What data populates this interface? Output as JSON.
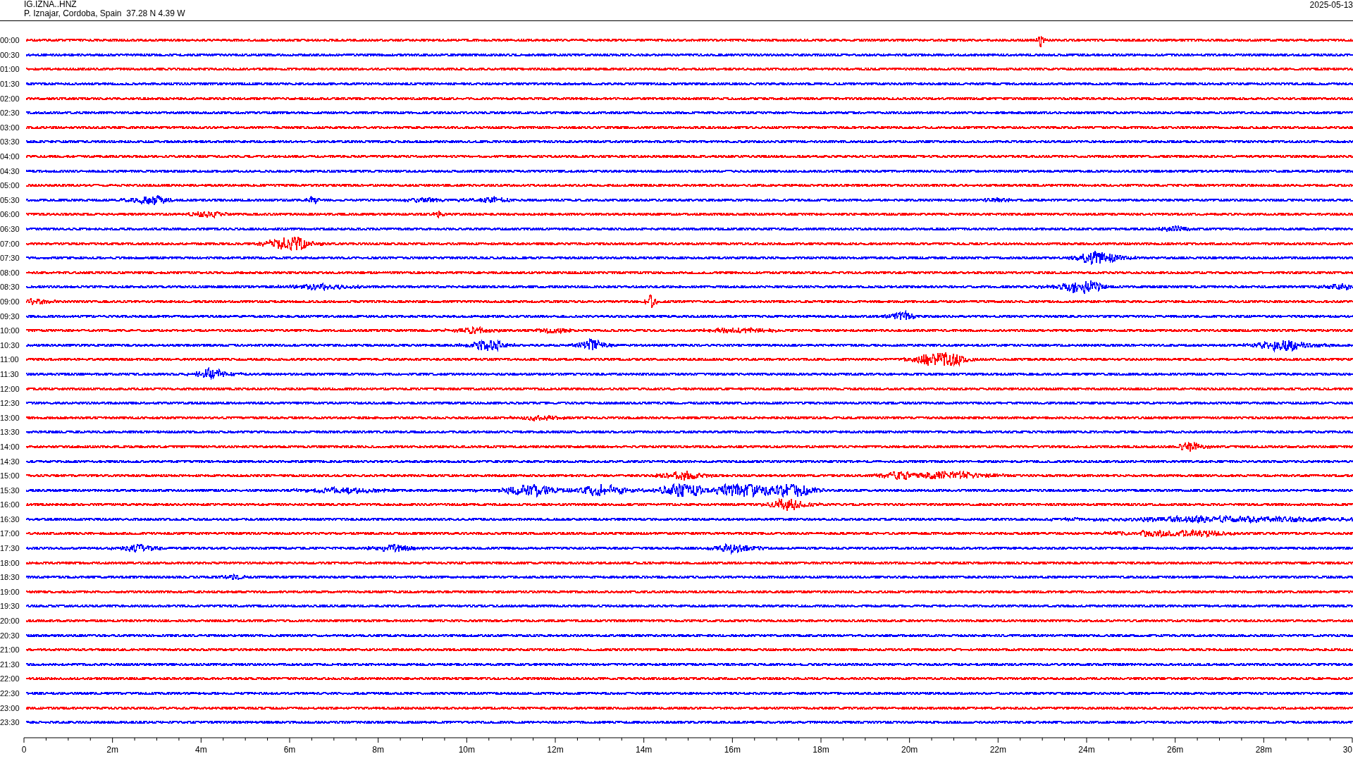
{
  "header": {
    "station": "IG.IZNA..HNZ",
    "location": "P. Iznajar, Cordoba, Spain  37.28 N 4.39 W",
    "date": "2025-05-13"
  },
  "rows": [
    {
      "time": "00:00",
      "color": "#ff0000"
    },
    {
      "time": "00:30",
      "color": "#0000ff"
    },
    {
      "time": "01:00",
      "color": "#ff0000"
    },
    {
      "time": "01:30",
      "color": "#0000ff"
    },
    {
      "time": "02:00",
      "color": "#ff0000"
    },
    {
      "time": "02:30",
      "color": "#0000ff"
    },
    {
      "time": "03:00",
      "color": "#ff0000"
    },
    {
      "time": "03:30",
      "color": "#0000ff"
    },
    {
      "time": "04:00",
      "color": "#ff0000"
    },
    {
      "time": "04:30",
      "color": "#0000ff"
    },
    {
      "time": "05:00",
      "color": "#ff0000"
    },
    {
      "time": "05:30",
      "color": "#0000ff"
    },
    {
      "time": "06:00",
      "color": "#ff0000"
    },
    {
      "time": "06:30",
      "color": "#0000ff"
    },
    {
      "time": "07:00",
      "color": "#ff0000"
    },
    {
      "time": "07:30",
      "color": "#0000ff"
    },
    {
      "time": "08:00",
      "color": "#ff0000"
    },
    {
      "time": "08:30",
      "color": "#0000ff"
    },
    {
      "time": "09:00",
      "color": "#ff0000"
    },
    {
      "time": "09:30",
      "color": "#0000ff"
    },
    {
      "time": "10:00",
      "color": "#ff0000"
    },
    {
      "time": "10:30",
      "color": "#0000ff"
    },
    {
      "time": "11:00",
      "color": "#ff0000"
    },
    {
      "time": "11:30",
      "color": "#0000ff"
    },
    {
      "time": "12:00",
      "color": "#ff0000"
    },
    {
      "time": "12:30",
      "color": "#0000ff"
    },
    {
      "time": "13:00",
      "color": "#ff0000"
    },
    {
      "time": "13:30",
      "color": "#0000ff"
    },
    {
      "time": "14:00",
      "color": "#ff0000"
    },
    {
      "time": "14:30",
      "color": "#0000ff"
    },
    {
      "time": "15:00",
      "color": "#ff0000"
    },
    {
      "time": "15:30",
      "color": "#0000ff"
    },
    {
      "time": "16:00",
      "color": "#ff0000"
    },
    {
      "time": "16:30",
      "color": "#0000ff"
    },
    {
      "time": "17:00",
      "color": "#ff0000"
    },
    {
      "time": "17:30",
      "color": "#0000ff"
    },
    {
      "time": "18:00",
      "color": "#ff0000"
    },
    {
      "time": "18:30",
      "color": "#0000ff"
    },
    {
      "time": "19:00",
      "color": "#ff0000"
    },
    {
      "time": "19:30",
      "color": "#0000ff"
    },
    {
      "time": "20:00",
      "color": "#ff0000"
    },
    {
      "time": "20:30",
      "color": "#0000ff"
    },
    {
      "time": "21:00",
      "color": "#ff0000"
    },
    {
      "time": "21:30",
      "color": "#0000ff"
    },
    {
      "time": "22:00",
      "color": "#ff0000"
    },
    {
      "time": "22:30",
      "color": "#0000ff"
    },
    {
      "time": "23:00",
      "color": "#ff0000"
    },
    {
      "time": "23:30",
      "color": "#0000ff"
    }
  ],
  "axis_labels": [
    "0",
    "2m",
    "4m",
    "6m",
    "8m",
    "10m",
    "12m",
    "14m",
    "16m",
    "18m",
    "20m",
    "22m",
    "24m",
    "26m",
    "28m",
    "30"
  ]
}
